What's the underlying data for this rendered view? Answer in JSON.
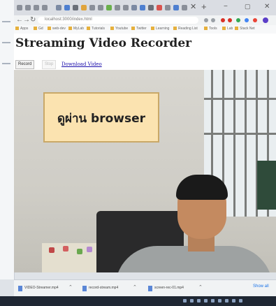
{
  "browser": {
    "url": "localhost:3000/index.html",
    "bookmarks": [
      "Apps",
      "Gd",
      "web-dev",
      "MyLab",
      "Tutorials",
      "Youtube",
      "Twitter",
      "Learning",
      "Reading List",
      "Tools",
      "Lab",
      "Stack Net"
    ]
  },
  "page": {
    "title": "Streaming Video Recorder",
    "tabs": {
      "record": "Record",
      "stop": "Stop"
    },
    "download_link": "Download Video"
  },
  "video": {
    "overlay_text": "ดูผ่าน browser"
  },
  "downloads": {
    "items": [
      "VIDEO-Streamer.mp4",
      "record-stream.mp4",
      "screen-rec-01.mp4"
    ],
    "show_all": "Show all"
  }
}
